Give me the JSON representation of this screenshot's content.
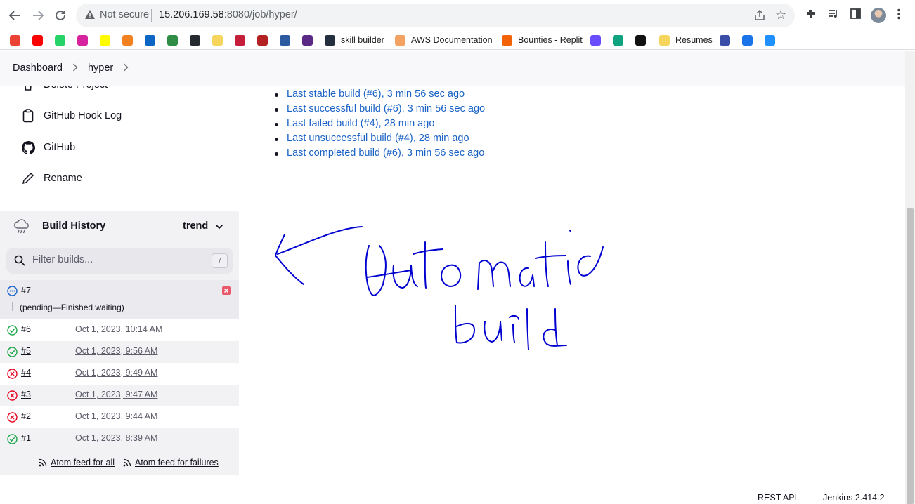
{
  "browser": {
    "security_label": "Not secure",
    "url_host": "15.206.169.58",
    "url_rest": ":8080/job/hyper/"
  },
  "bookmarks": [
    {
      "label": "",
      "icon": "gmail-icon",
      "color": "#ea4335"
    },
    {
      "label": "",
      "icon": "youtube-icon",
      "color": "#ff0000"
    },
    {
      "label": "",
      "icon": "whatsapp-icon",
      "color": "#25d366"
    },
    {
      "label": "",
      "icon": "instagram-icon",
      "color": "#d6249f"
    },
    {
      "label": "",
      "icon": "snapchat-icon",
      "color": "#fffc00"
    },
    {
      "label": "",
      "icon": "box-icon",
      "color": "#f48120"
    },
    {
      "label": "",
      "icon": "linkedin-icon",
      "color": "#0a66c2"
    },
    {
      "label": "",
      "icon": "geeksforgeeks-icon",
      "color": "#2f8d46"
    },
    {
      "label": "",
      "icon": "github-icon",
      "color": "#24292f"
    },
    {
      "label": "",
      "icon": "folder-icon",
      "color": "#f6d55c"
    },
    {
      "label": "",
      "icon": "bookmark-red-icon",
      "color": "#c41e3a"
    },
    {
      "label": "",
      "icon": "bookmark-circle-icon",
      "color": "#b22222"
    },
    {
      "label": "",
      "icon": "bookmark-blue-icon",
      "color": "#2c5aa0"
    },
    {
      "label": "",
      "icon": "vivaldi-icon",
      "color": "#5b2a86"
    },
    {
      "label": "skill builder",
      "icon": "aws-icon",
      "color": "#232f3e"
    },
    {
      "label": "AWS Documentation",
      "icon": "aws-docs-icon",
      "color": "#f4a261"
    },
    {
      "label": "Bounties - Replit",
      "icon": "replit-icon",
      "color": "#f26207"
    },
    {
      "label": "",
      "icon": "bookmark-purple-icon",
      "color": "#6a4cff"
    },
    {
      "label": "",
      "icon": "chatgpt-icon",
      "color": "#10a37f"
    },
    {
      "label": "",
      "icon": "bookmark-dark-icon",
      "color": "#111111"
    },
    {
      "label": "Resumes",
      "icon": "folder-icon",
      "color": "#f6d55c"
    },
    {
      "label": "",
      "icon": "cloud-icon",
      "color": "#3a4ea8"
    },
    {
      "label": "",
      "icon": "bookmark-c-icon",
      "color": "#1a73e8"
    },
    {
      "label": "",
      "icon": "bookmark-ring-icon",
      "color": "#1e90ff"
    }
  ],
  "breadcrumb": {
    "items": [
      "Dashboard",
      "hyper"
    ]
  },
  "sidebar": {
    "items": [
      {
        "label": "Delete Project",
        "icon": "trash-icon"
      },
      {
        "label": "GitHub Hook Log",
        "icon": "clipboard-icon"
      },
      {
        "label": "GitHub",
        "icon": "github-icon"
      },
      {
        "label": "Rename",
        "icon": "pencil-icon"
      }
    ]
  },
  "permalinks": [
    "Last stable build (#6), 3 min 56 sec ago",
    "Last successful build (#6), 3 min 56 sec ago",
    "Last failed build (#4), 28 min ago",
    "Last unsuccessful build (#4), 28 min ago",
    "Last completed build (#6), 3 min 56 sec ago"
  ],
  "build_history": {
    "title": "Build History",
    "trend_label": "trend",
    "filter_placeholder": "Filter builds...",
    "filter_shortcut": "/",
    "pending": {
      "number": "#7",
      "status_text": "(pending—Finished waiting)"
    },
    "builds": [
      {
        "number": "#6",
        "date": "Oct 1, 2023, 10:14 AM",
        "status": "success"
      },
      {
        "number": "#5",
        "date": "Oct 1, 2023, 9:56 AM",
        "status": "success"
      },
      {
        "number": "#4",
        "date": "Oct 1, 2023, 9:49 AM",
        "status": "failed"
      },
      {
        "number": "#3",
        "date": "Oct 1, 2023, 9:47 AM",
        "status": "failed"
      },
      {
        "number": "#2",
        "date": "Oct 1, 2023, 9:44 AM",
        "status": "failed"
      },
      {
        "number": "#1",
        "date": "Oct 1, 2023, 8:39 AM",
        "status": "success"
      }
    ],
    "feed_all": "Atom feed for all",
    "feed_failures": "Atom feed for failures"
  },
  "footer": {
    "rest_api": "REST API",
    "version": "Jenkins 2.414.2"
  },
  "annotation": {
    "line1": "Automatic",
    "line2": "build",
    "ink_color": "#0000d0"
  },
  "colors": {
    "success": "#1ea64b",
    "failed": "#e6001f",
    "pending": "#1a62c6",
    "link": "#1a62c6"
  }
}
